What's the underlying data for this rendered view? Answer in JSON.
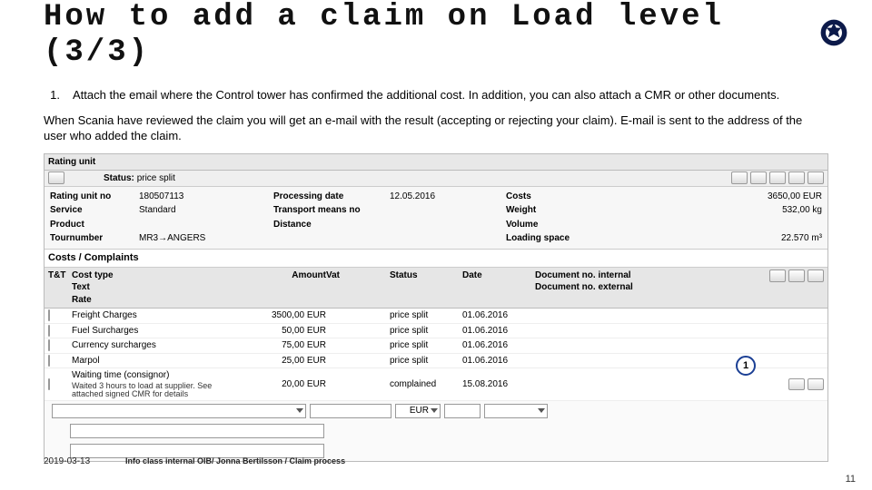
{
  "title_line": "How to add a claim on Load level (3/3)",
  "step": {
    "num": "1.",
    "text": "Attach the email where the Control tower has confirmed the additional cost. In addition, you can also attach a CMR or other documents."
  },
  "para": "When Scania have reviewed the claim you will get an e-mail with the result (accepting or rejecting your claim). E-mail is sent to the address of the user who added the claim.",
  "panel": {
    "title": "Rating unit",
    "status_lbl": "Status:",
    "status_val": "price split"
  },
  "kv": {
    "r1": {
      "l1": "Rating unit no",
      "v1": "180507113",
      "l2": "Processing date",
      "v2": "12.05.2016",
      "l3": "Costs",
      "v3": "3650,00 EUR"
    },
    "r2": {
      "l1": "Service",
      "v1": "Standard",
      "l2": "Transport means no",
      "v2": "",
      "l3": "Weight",
      "v3": "532,00 kg"
    },
    "r3": {
      "l1": "Product",
      "v1": "",
      "l2": "Distance",
      "v2": "",
      "l3": "Volume",
      "v3": ""
    },
    "r4": {
      "l1": "Tournumber",
      "v1": "MR3→ANGERS",
      "l2": "",
      "v2": "",
      "l3": "Loading space",
      "v3": "22.570 m³"
    }
  },
  "section2": "Costs / Complaints",
  "th": {
    "c0": "T&T",
    "c1": "Cost type",
    "c1b": "Text",
    "c1c": "Rate",
    "c2": "Amount",
    "c3": "Vat",
    "c4": "Status",
    "c5": "Date",
    "c6": "Document no. internal",
    "c6b": "Document no. external"
  },
  "rows": [
    {
      "name": "Freight Charges",
      "amt": "3500,00 EUR",
      "status": "price split",
      "date": "01.06.2016"
    },
    {
      "name": "Fuel Surcharges",
      "amt": "50,00 EUR",
      "status": "price split",
      "date": "01.06.2016"
    },
    {
      "name": "Currency surcharges",
      "amt": "75,00 EUR",
      "status": "price split",
      "date": "01.06.2016"
    },
    {
      "name": "Marpol",
      "amt": "25,00 EUR",
      "status": "price split",
      "date": "01.06.2016"
    },
    {
      "name": "Waiting time (consignor)",
      "sub": "Waited 3 hours to load at supplier. See attached signed CMR for details",
      "amt": "20,00 EUR",
      "status": "complained",
      "date": "15.08.2016"
    }
  ],
  "form": {
    "cur": "EUR"
  },
  "callout1": "1",
  "footer": {
    "date": "2019-03-13",
    "info": "Info class internal OIB/ Jonna Bertilsson / Claim process"
  },
  "pagenum": "11"
}
